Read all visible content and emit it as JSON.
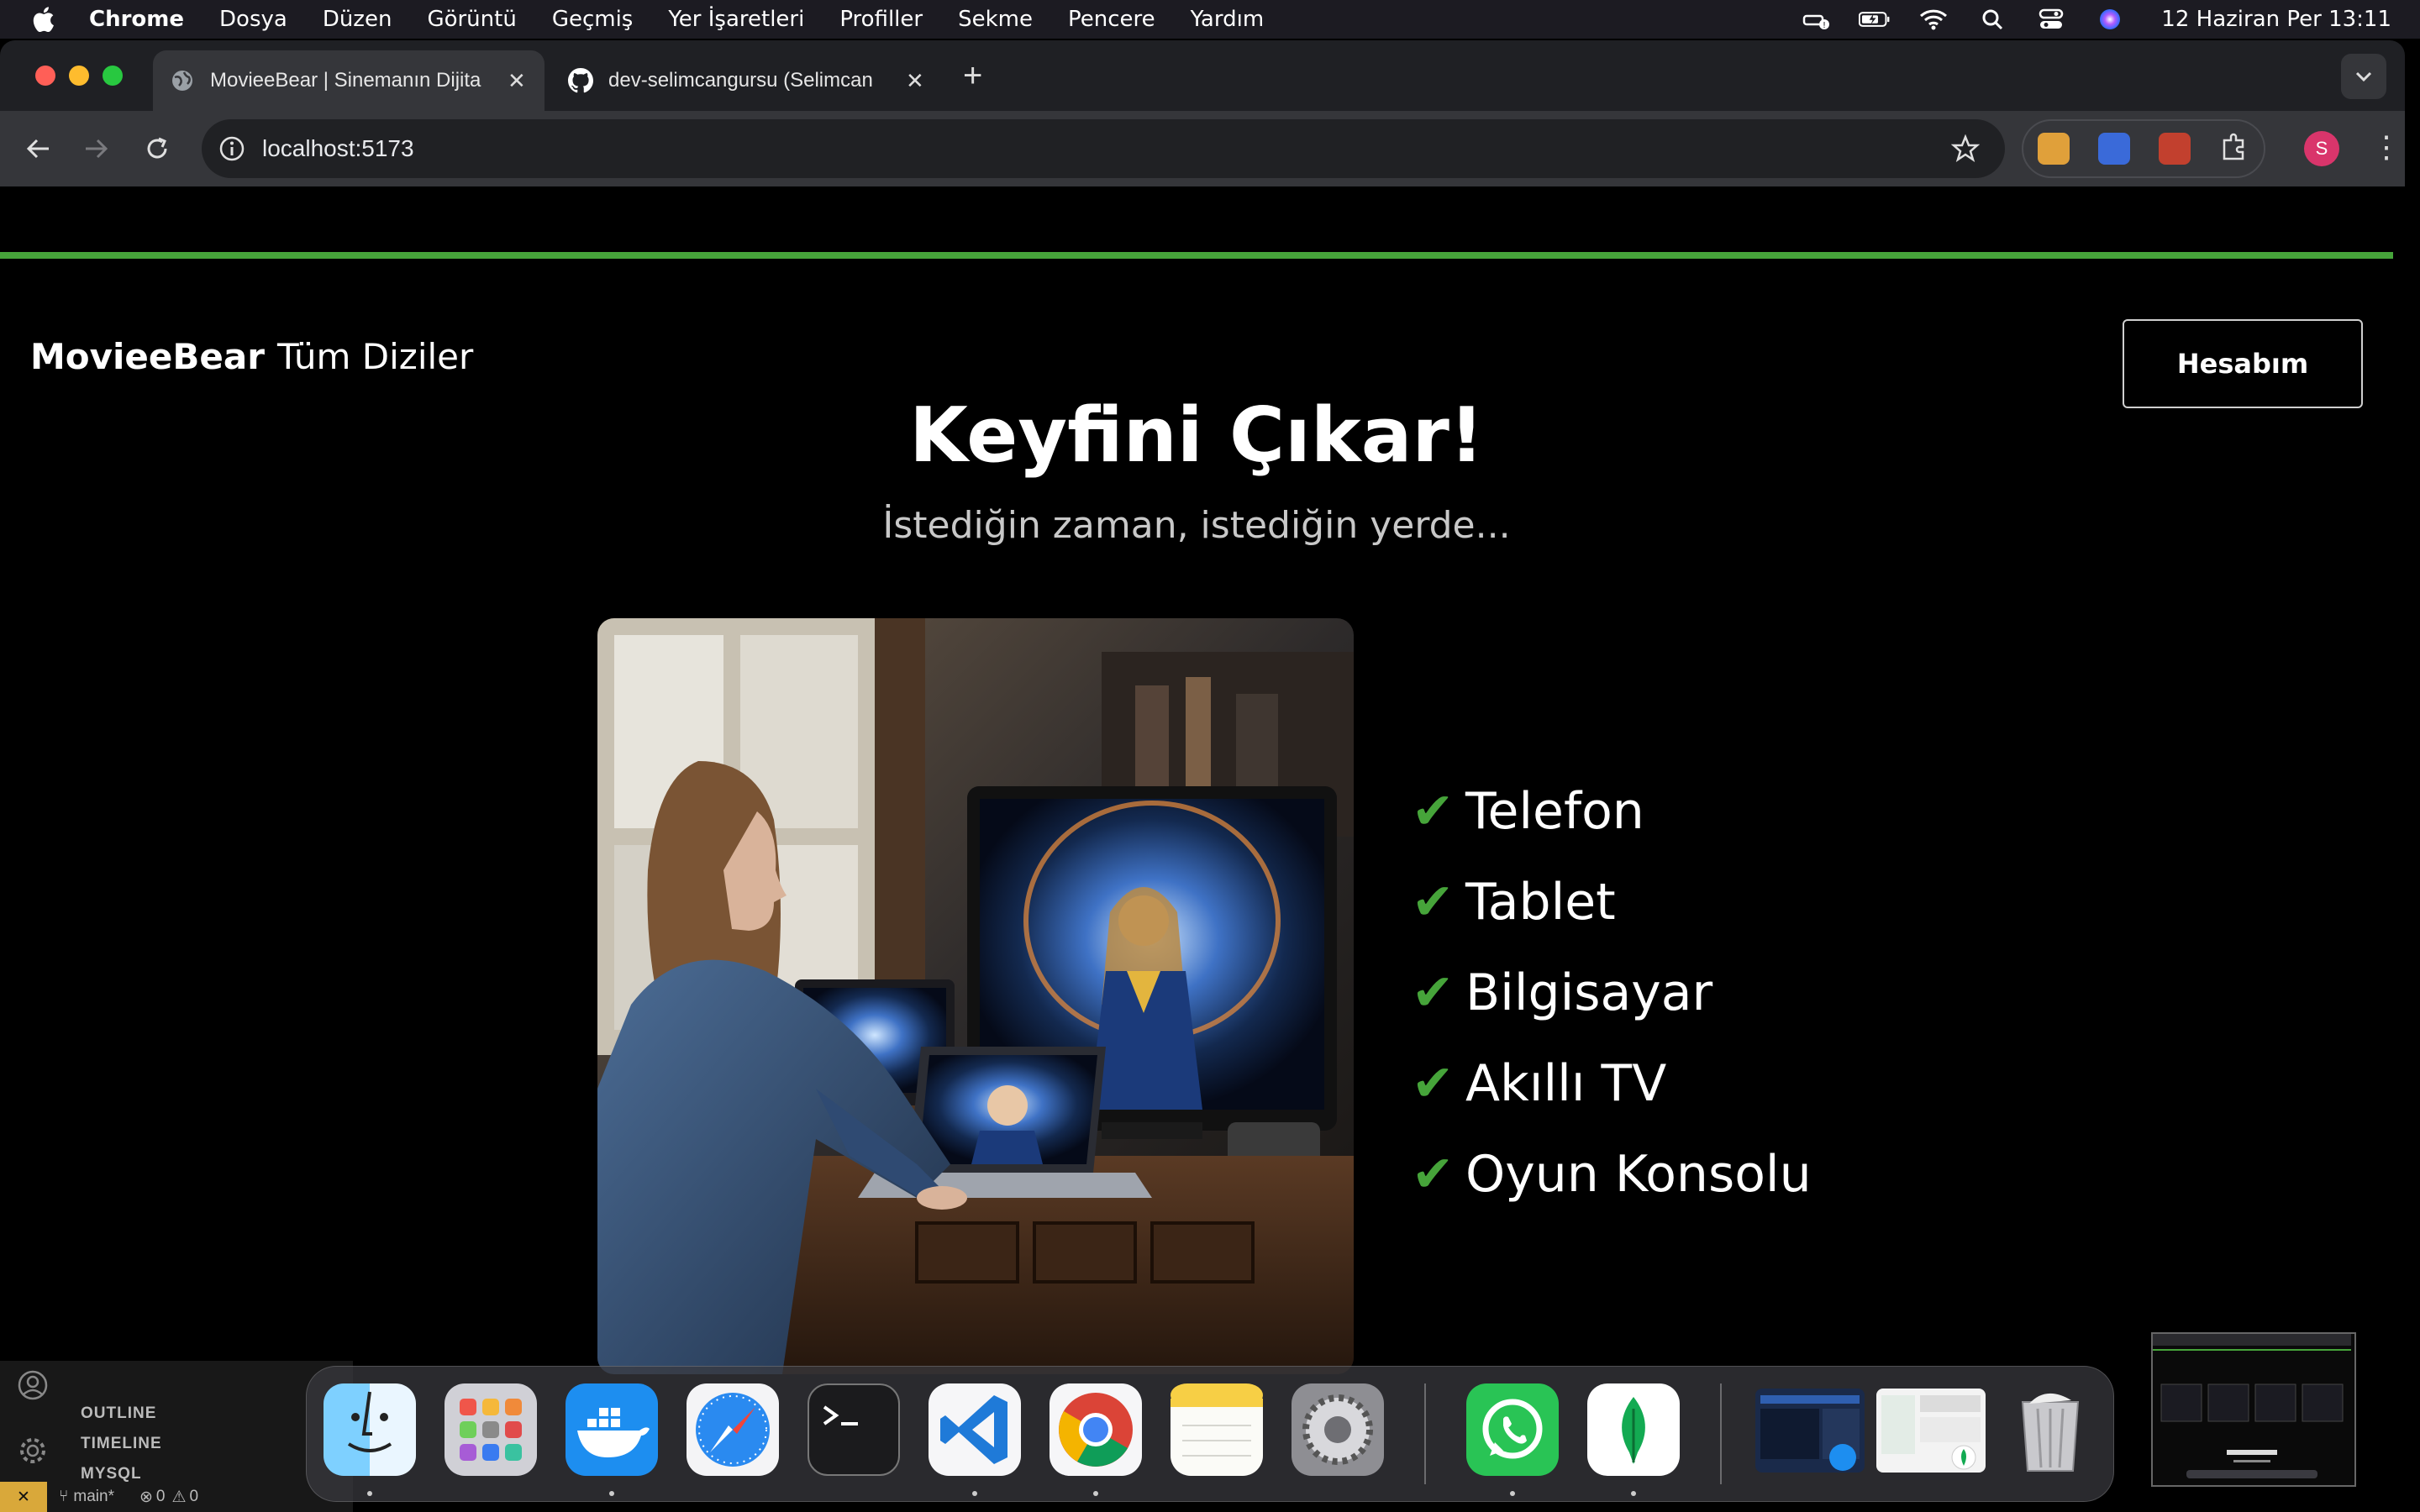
{
  "menubar": {
    "app_name": "Chrome",
    "items": [
      "Dosya",
      "Düzen",
      "Görüntü",
      "Geçmiş",
      "Yer İşaretleri",
      "Profiller",
      "Sekme",
      "Pencere",
      "Yardım"
    ],
    "clock": "12 Haziran Per  13:11"
  },
  "tabs": [
    {
      "title": "MovieeBear | Sinemanın Dijita",
      "icon": "globe-icon"
    },
    {
      "title": "dev-selimcangursu (Selimcan",
      "icon": "github-icon"
    }
  ],
  "toolbar": {
    "url": "localhost:5173",
    "profile_initial": "S"
  },
  "site": {
    "brand": "MovieeBear",
    "nav_series": "Tüm Diziler",
    "account_button": "Hesabım",
    "hero_title": "Keyfini Çıkar!",
    "hero_subtitle": "İstediğin zaman, istediğin yerde...",
    "check_mark": "✔",
    "devices": [
      "Telefon",
      "Tablet",
      "Bilgisayar",
      "Akıllı TV",
      "Oyun Konsolu"
    ]
  },
  "vscode": {
    "sections": [
      "OUTLINE",
      "TIMELINE",
      "MYSQL"
    ],
    "branch": "main*",
    "errors": "0",
    "warnings": "0"
  },
  "dock": [
    "Finder",
    "Launchpad",
    "Docker",
    "Safari",
    "Terminal",
    "VS Code",
    "Chrome",
    "Notes",
    "System Settings",
    "WhatsApp",
    "MongoDB Compass",
    "Trash"
  ],
  "colors": {
    "accent_green": "#46a43a",
    "page_bg": "#000000",
    "profile": "#d9356b"
  }
}
